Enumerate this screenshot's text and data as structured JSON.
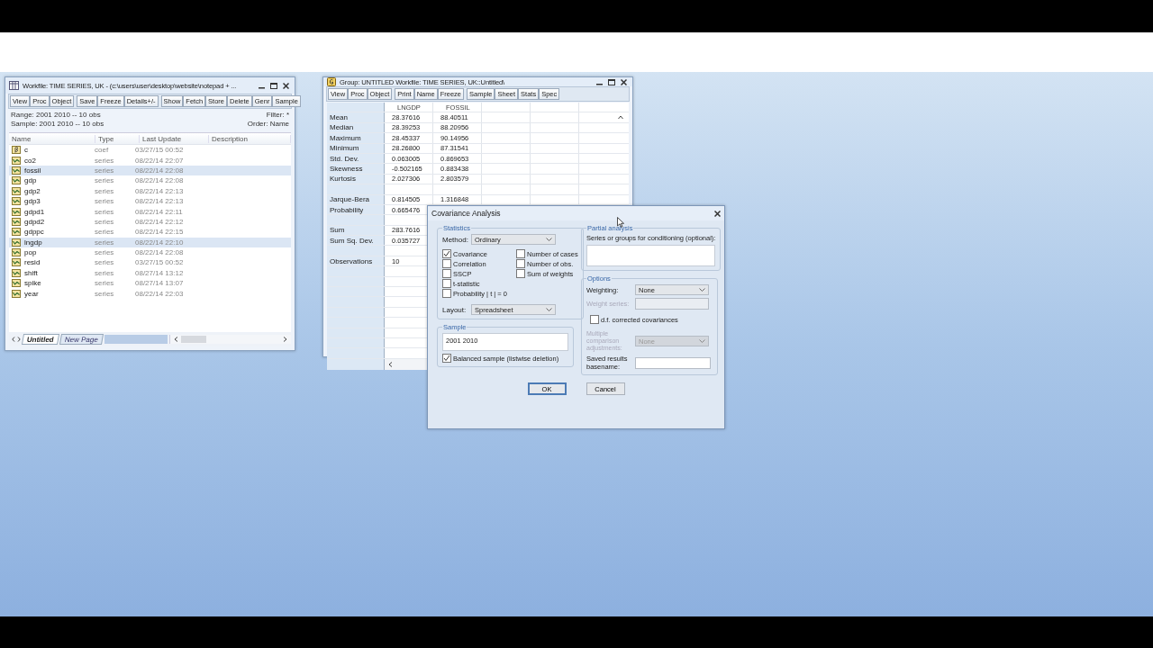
{
  "workfile": {
    "title": "Workfile: TIME SERIES, UK - (c:\\users\\user\\desktop\\website\\notepad + ...",
    "toolbar": [
      [
        "View",
        "Proc",
        "Object"
      ],
      [
        "Save",
        "Freeze",
        "Details+/-"
      ],
      [
        "Show",
        "Fetch",
        "Store",
        "Delete",
        "Genr",
        "Sample"
      ]
    ],
    "range": "Range:  2001 2010   --   10 obs",
    "sample": "Sample: 2001 2010   --   10 obs",
    "filter": "Filter: *",
    "order": "Order: Name",
    "columns": [
      "Name",
      "Type",
      "Last Update",
      "Description"
    ],
    "rows": [
      {
        "name": "c",
        "kind": "coef",
        "type": "coef",
        "updated": "03/27/15  00:52",
        "selected": false
      },
      {
        "name": "co2",
        "kind": "series",
        "type": "series",
        "updated": "08/22/14  22:07",
        "selected": false
      },
      {
        "name": "fossil",
        "kind": "series",
        "type": "series",
        "updated": "08/22/14  22:08",
        "selected": true
      },
      {
        "name": "gdp",
        "kind": "series",
        "type": "series",
        "updated": "08/22/14  22:08",
        "selected": false
      },
      {
        "name": "gdp2",
        "kind": "series",
        "type": "series",
        "updated": "08/22/14  22:13",
        "selected": false
      },
      {
        "name": "gdp3",
        "kind": "series",
        "type": "series",
        "updated": "08/22/14  22:13",
        "selected": false
      },
      {
        "name": "gdpd1",
        "kind": "series",
        "type": "series",
        "updated": "08/22/14  22:11",
        "selected": false
      },
      {
        "name": "gdpd2",
        "kind": "series",
        "type": "series",
        "updated": "08/22/14  22:12",
        "selected": false
      },
      {
        "name": "gdppc",
        "kind": "series",
        "type": "series",
        "updated": "08/22/14  22:15",
        "selected": false
      },
      {
        "name": "lngdp",
        "kind": "series",
        "type": "series",
        "updated": "08/22/14  22:10",
        "selected": true
      },
      {
        "name": "pop",
        "kind": "series",
        "type": "series",
        "updated": "08/22/14  22:08",
        "selected": false
      },
      {
        "name": "resid",
        "kind": "series",
        "type": "series",
        "updated": "03/27/15  00:52",
        "selected": false
      },
      {
        "name": "shift",
        "kind": "series",
        "type": "series",
        "updated": "08/27/14  13:12",
        "selected": false
      },
      {
        "name": "spike",
        "kind": "series",
        "type": "series",
        "updated": "08/27/14  13:07",
        "selected": false
      },
      {
        "name": "year",
        "kind": "series",
        "type": "series",
        "updated": "08/22/14  22:03",
        "selected": false
      }
    ],
    "tabs": [
      {
        "label": "Untitled",
        "selected": true
      },
      {
        "label": "New Page",
        "selected": false
      }
    ]
  },
  "group": {
    "title": "Group: UNTITLED   Workfile: TIME SERIES, UK::Untitled\\",
    "toolbar": [
      [
        "View",
        "Proc",
        "Object"
      ],
      [
        "Print",
        "Name",
        "Freeze"
      ],
      [
        "Sample",
        "Sheet",
        "Stats",
        "Spec"
      ]
    ],
    "columns": [
      "LNGDP",
      "FOSSIL"
    ],
    "rows": [
      {
        "label": "Mean",
        "values": [
          "28.37616",
          "88.40511"
        ]
      },
      {
        "label": "Median",
        "values": [
          "28.39253",
          "88.20956"
        ]
      },
      {
        "label": "Maximum",
        "values": [
          "28.45337",
          "90.14956"
        ]
      },
      {
        "label": "Minimum",
        "values": [
          "28.26800",
          "87.31541"
        ]
      },
      {
        "label": "Std. Dev.",
        "values": [
          "0.063005",
          "0.869653"
        ]
      },
      {
        "label": "Skewness",
        "values": [
          "-0.502165",
          "0.883438"
        ]
      },
      {
        "label": "Kurtosis",
        "values": [
          "2.027306",
          "2.803579"
        ]
      },
      {
        "label": "",
        "values": []
      },
      {
        "label": "Jarque-Bera",
        "values": [
          "0.814505",
          "1.316848"
        ]
      },
      {
        "label": "Probability",
        "values": [
          "0.665476"
        ]
      },
      {
        "label": "",
        "values": []
      },
      {
        "label": "Sum",
        "values": [
          "283.7616"
        ]
      },
      {
        "label": "Sum Sq. Dev.",
        "values": [
          "0.035727"
        ]
      },
      {
        "label": "",
        "values": []
      },
      {
        "label": "Observations",
        "values": [
          "10"
        ]
      }
    ]
  },
  "dialog": {
    "title": "Covariance Analysis",
    "statistics": {
      "legend": "Statistics",
      "method_label": "Method:",
      "method": "Ordinary",
      "checks_left": [
        {
          "label": "Covariance",
          "checked": true
        },
        {
          "label": "Correlation",
          "checked": false
        },
        {
          "label": "SSCP",
          "checked": false
        },
        {
          "label": "t-statistic",
          "checked": false
        },
        {
          "label": "Probability | t | = 0",
          "checked": false
        }
      ],
      "checks_right": [
        {
          "label": "Number of cases",
          "checked": false
        },
        {
          "label": "Number of obs.",
          "checked": false
        },
        {
          "label": "Sum of weights",
          "checked": false
        }
      ],
      "layout_label": "Layout:",
      "layout": "Spreadsheet"
    },
    "sample": {
      "legend": "Sample",
      "value": "2001 2010",
      "balanced": {
        "label": "Balanced sample (listwise deletion)",
        "checked": true
      }
    },
    "partial": {
      "legend": "Partial analysis",
      "label": "Series or groups for conditioning (optional):"
    },
    "options": {
      "legend": "Options",
      "weighting_label": "Weighting:",
      "weighting": "None",
      "weight_series": {
        "label": "Weight series:",
        "disabled": true
      },
      "df": {
        "label": "d.f. corrected covariances",
        "checked": false
      },
      "multiple": {
        "label": "Multiple comparison adjustments:",
        "value": "None",
        "disabled": true
      },
      "basename_label": "Saved results basename:"
    },
    "buttons": [
      "OK",
      "Cancel"
    ]
  }
}
